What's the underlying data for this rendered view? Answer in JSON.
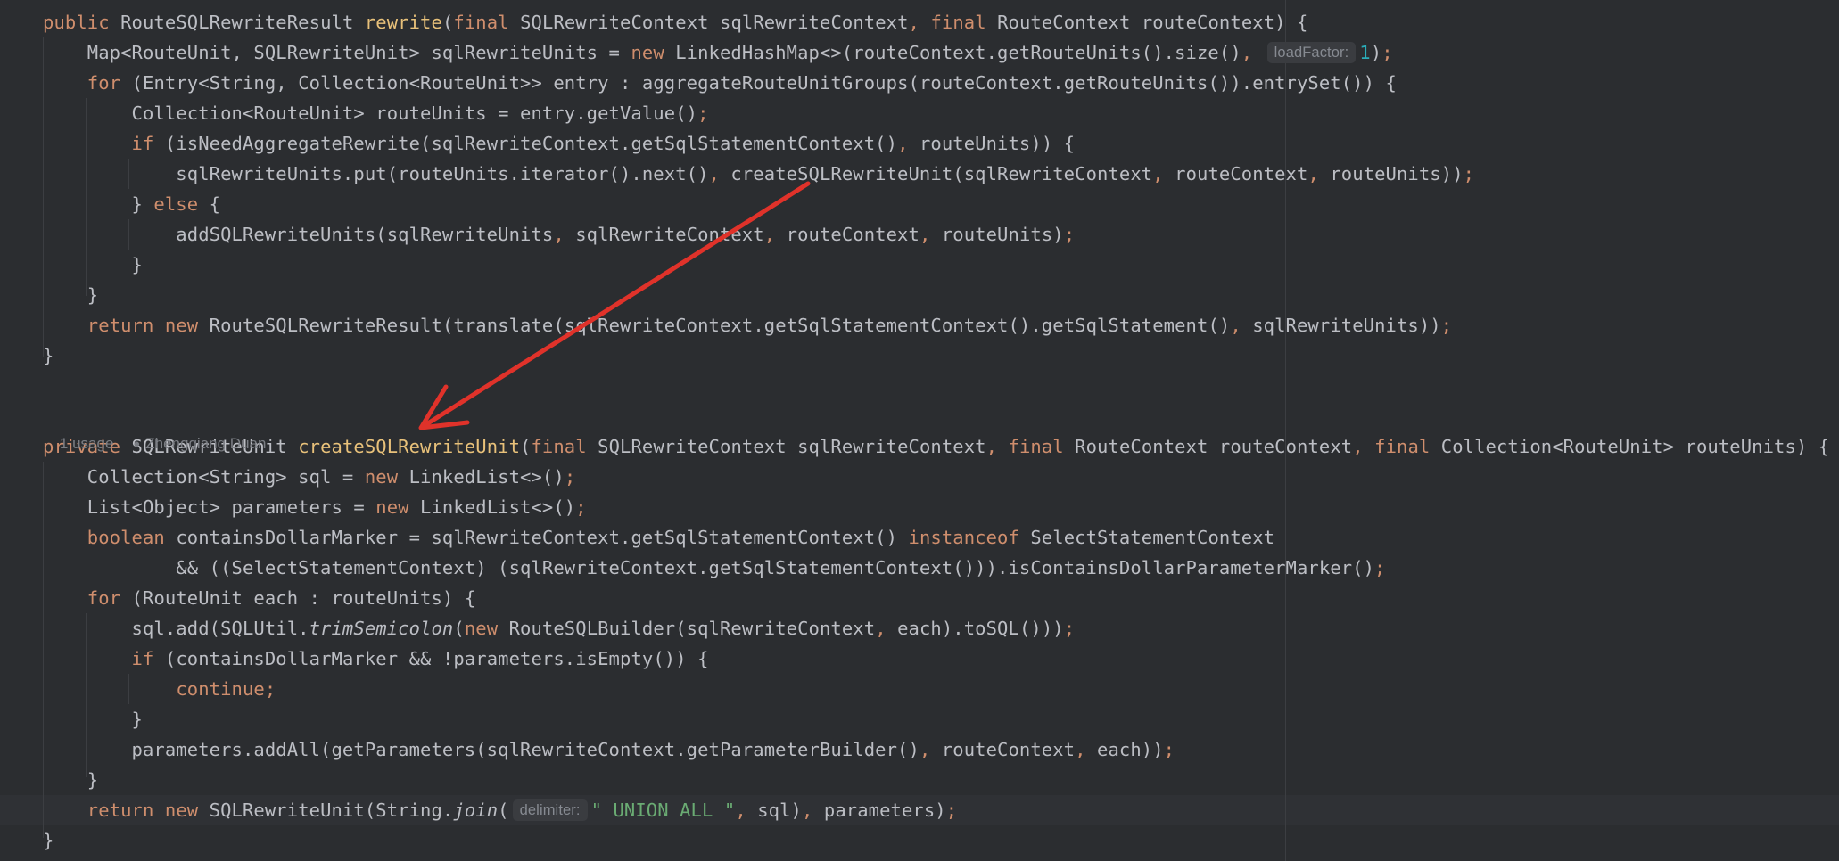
{
  "editor": {
    "lines": [
      {
        "segs": [
          [
            "kw",
            "public "
          ],
          [
            "",
            "RouteSQLRewriteResult "
          ],
          [
            "fnd",
            "rewrite"
          ],
          [
            "",
            "("
          ],
          [
            "kw",
            "final "
          ],
          [
            "",
            "SQLRewriteContext sqlRewriteContext"
          ],
          [
            "kw",
            ", "
          ],
          [
            "kw",
            "final "
          ],
          [
            "",
            "RouteContext routeContext) {"
          ]
        ]
      },
      {
        "segs": [
          [
            "",
            "    Map<RouteUnit, SQLRewriteUnit> sqlRewriteUnits = "
          ],
          [
            "kw",
            "new "
          ],
          [
            "",
            "LinkedHashMap<>(routeContext.getRouteUnits().size()"
          ],
          [
            "kw",
            ", "
          ],
          [
            "hint",
            "loadFactor:"
          ],
          [
            "num",
            "1"
          ],
          [
            "",
            ")"
          ],
          [
            "kw",
            ";"
          ]
        ]
      },
      {
        "segs": [
          [
            "",
            "    "
          ],
          [
            "kw",
            "for "
          ],
          [
            "",
            "(Entry<String, Collection<RouteUnit>> entry : aggregateRouteUnitGroups(routeContext.getRouteUnits()).entrySet()) {"
          ]
        ]
      },
      {
        "segs": [
          [
            "",
            "        Collection<RouteUnit> routeUnits = entry.getValue()"
          ],
          [
            "kw",
            ";"
          ]
        ]
      },
      {
        "segs": [
          [
            "",
            "        "
          ],
          [
            "kw",
            "if "
          ],
          [
            "",
            "(isNeedAggregateRewrite(sqlRewriteContext.getSqlStatementContext()"
          ],
          [
            "kw",
            ", "
          ],
          [
            "",
            "routeUnits)) {"
          ]
        ]
      },
      {
        "segs": [
          [
            "",
            "            sqlRewriteUnits.put(routeUnits.iterator().next()"
          ],
          [
            "kw",
            ", "
          ],
          [
            "",
            "createSQLRewriteUnit(sqlRewriteContext"
          ],
          [
            "kw",
            ", "
          ],
          [
            "",
            "routeContext"
          ],
          [
            "kw",
            ", "
          ],
          [
            "",
            "routeUnits))"
          ],
          [
            "kw",
            ";"
          ]
        ]
      },
      {
        "segs": [
          [
            "",
            "        } "
          ],
          [
            "kw",
            "else "
          ],
          [
            "",
            "{"
          ]
        ]
      },
      {
        "segs": [
          [
            "",
            "            addSQLRewriteUnits(sqlRewriteUnits"
          ],
          [
            "kw",
            ", "
          ],
          [
            "",
            "sqlRewriteContext"
          ],
          [
            "kw",
            ", "
          ],
          [
            "",
            "routeContext"
          ],
          [
            "kw",
            ", "
          ],
          [
            "",
            "routeUnits)"
          ],
          [
            "kw",
            ";"
          ]
        ]
      },
      {
        "segs": [
          [
            "",
            "        }"
          ]
        ]
      },
      {
        "segs": [
          [
            "",
            "    }"
          ]
        ]
      },
      {
        "segs": [
          [
            "",
            "    "
          ],
          [
            "kw",
            "return new "
          ],
          [
            "",
            "RouteSQLRewriteResult(translate(sqlRewriteContext.getSqlStatementContext().getSqlStatement()"
          ],
          [
            "kw",
            ", "
          ],
          [
            "",
            "sqlRewriteUnits))"
          ],
          [
            "kw",
            ";"
          ]
        ]
      },
      {
        "segs": [
          [
            "",
            "}"
          ]
        ]
      },
      {
        "segs": [
          [
            "",
            ""
          ]
        ]
      },
      {
        "segs": [
          [
            "",
            "private "
          ],
          [
            "",
            ""
          ]
        ],
        "meta": true
      },
      {
        "segs": [
          [
            "kw",
            "private "
          ],
          [
            "",
            "SQLRewriteUnit "
          ],
          [
            "fnd",
            "createSQLRewriteUnit"
          ],
          [
            "",
            "("
          ],
          [
            "kw",
            "final "
          ],
          [
            "",
            "SQLRewriteContext sqlRewriteContext"
          ],
          [
            "kw",
            ", "
          ],
          [
            "kw",
            "final "
          ],
          [
            "",
            "RouteContext routeContext"
          ],
          [
            "kw",
            ", "
          ],
          [
            "kw",
            "final "
          ],
          [
            "",
            "Collection<RouteUnit> routeUnits) {"
          ]
        ]
      },
      {
        "segs": [
          [
            "",
            "    Collection<String> sql = "
          ],
          [
            "kw",
            "new "
          ],
          [
            "",
            "LinkedList<>()"
          ],
          [
            "kw",
            ";"
          ]
        ]
      },
      {
        "segs": [
          [
            "",
            "    List<Object> parameters = "
          ],
          [
            "kw",
            "new "
          ],
          [
            "",
            "LinkedList<>()"
          ],
          [
            "kw",
            ";"
          ]
        ]
      },
      {
        "segs": [
          [
            "",
            "    "
          ],
          [
            "kw",
            "boolean "
          ],
          [
            "",
            "containsDollarMarker = sqlRewriteContext.getSqlStatementContext() "
          ],
          [
            "kw",
            "instanceof "
          ],
          [
            "",
            "SelectStatementContext"
          ]
        ]
      },
      {
        "segs": [
          [
            "",
            "            && ((SelectStatementContext) (sqlRewriteContext.getSqlStatementContext())).isContainsDollarParameterMarker()"
          ],
          [
            "kw",
            ";"
          ]
        ]
      },
      {
        "segs": [
          [
            "",
            "    "
          ],
          [
            "kw",
            "for "
          ],
          [
            "",
            "(RouteUnit each : routeUnits) {"
          ]
        ]
      },
      {
        "segs": [
          [
            "",
            "        sql.add(SQLUtil."
          ],
          [
            "it",
            "trimSemicolon"
          ],
          [
            "",
            "("
          ],
          [
            "kw",
            "new "
          ],
          [
            "",
            "RouteSQLBuilder(sqlRewriteContext"
          ],
          [
            "kw",
            ", "
          ],
          [
            "",
            "each).toSQL()))"
          ],
          [
            "kw",
            ";"
          ]
        ]
      },
      {
        "segs": [
          [
            "",
            "        "
          ],
          [
            "kw",
            "if "
          ],
          [
            "",
            "(containsDollarMarker && !parameters.isEmpty()) {"
          ]
        ]
      },
      {
        "segs": [
          [
            "",
            "            "
          ],
          [
            "kw",
            "continue;"
          ]
        ]
      },
      {
        "segs": [
          [
            "",
            "        }"
          ]
        ]
      },
      {
        "segs": [
          [
            "",
            "        parameters.addAll(getParameters(sqlRewriteContext.getParameterBuilder()"
          ],
          [
            "kw",
            ", "
          ],
          [
            "",
            "routeContext"
          ],
          [
            "kw",
            ", "
          ],
          [
            "",
            "each))"
          ],
          [
            "kw",
            ";"
          ]
        ]
      },
      {
        "segs": [
          [
            "",
            "    }"
          ]
        ]
      },
      {
        "segs": [
          [
            "",
            "    "
          ],
          [
            "kw",
            "return new "
          ],
          [
            "",
            "SQLRewriteUnit(String."
          ],
          [
            "it",
            "join"
          ],
          [
            "",
            "("
          ],
          [
            "hint",
            "delimiter:"
          ],
          [
            "str",
            "\" UNION ALL \""
          ],
          [
            "kw",
            ", "
          ],
          [
            "",
            "sql)"
          ],
          [
            "kw",
            ", "
          ],
          [
            "",
            "parameters)"
          ],
          [
            "kw",
            ";"
          ]
        ]
      },
      {
        "segs": [
          [
            "",
            "}"
          ]
        ]
      }
    ],
    "usage_hint": "1 usage",
    "author_hint": "Zhengqiang Duan",
    "colors": {
      "background": "#2b2d30",
      "keyword": "#cf8e6d",
      "method_decl": "#e8c17a",
      "number": "#2aacb8",
      "string": "#6aab73",
      "text": "#bcbec4",
      "annotation_arrow": "#e0322a"
    }
  }
}
